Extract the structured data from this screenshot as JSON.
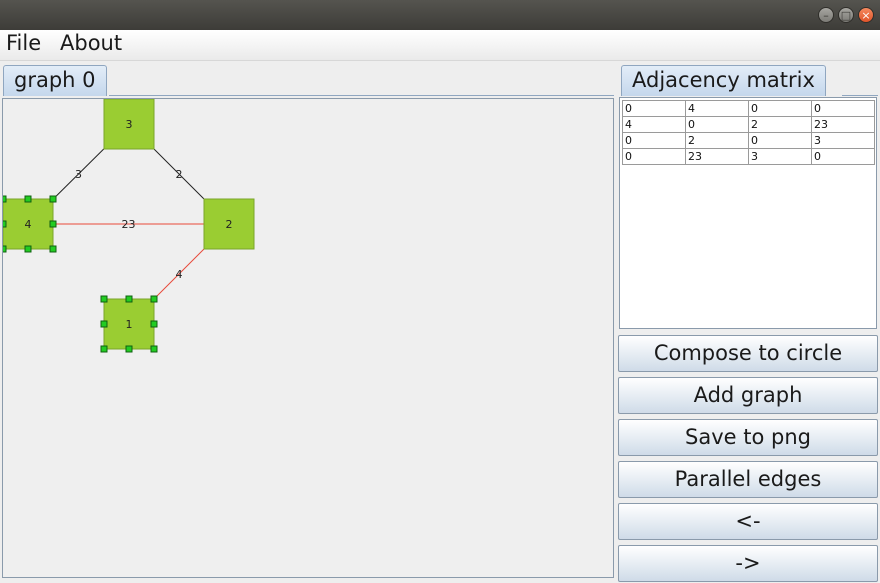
{
  "window": {
    "controls": [
      "minimize-icon",
      "maximize-icon",
      "close-icon"
    ]
  },
  "menu": {
    "file": "File",
    "about": "About"
  },
  "tabs": {
    "graph_tab": "graph 0",
    "matrix_tab": "Adjacency matrix"
  },
  "graph": {
    "vertices": [
      {
        "label": "3",
        "selected": false
      },
      {
        "label": "4",
        "selected": true
      },
      {
        "label": "2",
        "selected": false
      },
      {
        "label": "1",
        "selected": true
      }
    ],
    "edges": [
      {
        "from": "3",
        "to": "4",
        "weight": "3",
        "highlighted": false
      },
      {
        "from": "3",
        "to": "2",
        "weight": "2",
        "highlighted": false
      },
      {
        "from": "4",
        "to": "2",
        "weight": "23",
        "highlighted": true
      },
      {
        "from": "2",
        "to": "1",
        "weight": "4",
        "highlighted": true
      }
    ],
    "colors": {
      "vertex": "#9acd32",
      "edge": "#222222",
      "highlighted_edge": "#e8493a",
      "handle": "#22cc22"
    }
  },
  "matrix": {
    "rows": [
      [
        "0",
        "4",
        "0",
        "0"
      ],
      [
        "4",
        "0",
        "2",
        "23"
      ],
      [
        "0",
        "2",
        "0",
        "3"
      ],
      [
        "0",
        "23",
        "3",
        "0"
      ]
    ]
  },
  "buttons": {
    "compose": "Compose to circle",
    "add_graph": "Add graph",
    "save_png": "Save to png",
    "parallel": "Parallel edges",
    "prev": "<-",
    "next": "->"
  }
}
